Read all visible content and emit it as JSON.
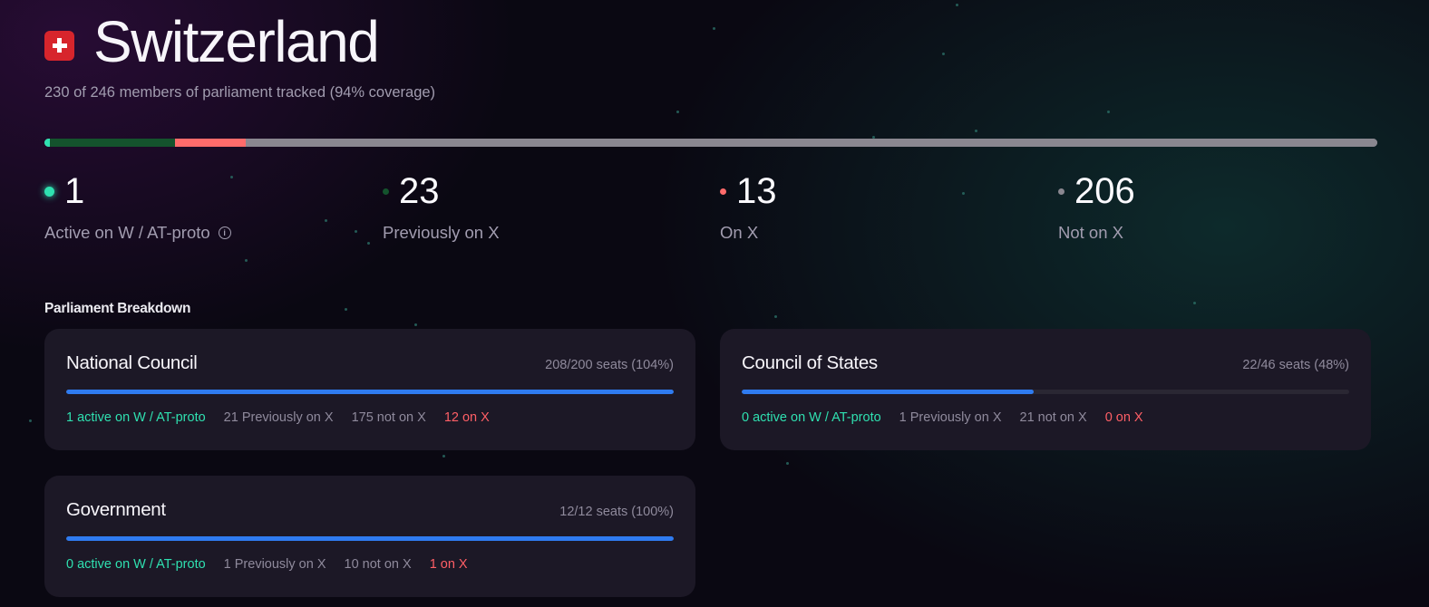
{
  "header": {
    "flag_icon": "swiss-flag-icon",
    "title": "Switzerland",
    "subtitle": "230 of 246 members of parliament tracked (94% coverage)"
  },
  "overall_bar": {
    "segments": [
      {
        "name": "active",
        "fraction": 0.004,
        "color": "#2fe0b0"
      },
      {
        "name": "previously",
        "fraction": 0.094,
        "color": "#14532d"
      },
      {
        "name": "on-x",
        "fraction": 0.053,
        "color": "#ff6b6b"
      },
      {
        "name": "not-on-x",
        "fraction": 0.849,
        "color": "#8a8790"
      }
    ]
  },
  "stats": [
    {
      "key": "active",
      "value": "1",
      "label": "Active on W / AT-proto",
      "color": "#2fe0b0",
      "info": true
    },
    {
      "key": "previously",
      "value": "23",
      "label": "Previously on X",
      "color": "#14532d",
      "info": false
    },
    {
      "key": "on-x",
      "value": "13",
      "label": "On X",
      "color": "#ff6b6b",
      "info": false
    },
    {
      "key": "not-on-x",
      "value": "206",
      "label": "Not on X",
      "color": "#8a8790",
      "info": false
    }
  ],
  "section_title": "Parliament Breakdown",
  "cards": [
    {
      "title": "National Council",
      "seats": "208/200 seats (104%)",
      "fill_fraction": 1.0,
      "active": "1 active on W / AT-proto",
      "previously": "21 Previously on X",
      "not_on_x": "175 not on X",
      "on_x": "12 on X"
    },
    {
      "title": "Council of States",
      "seats": "22/46 seats (48%)",
      "fill_fraction": 0.48,
      "active": "0 active on W / AT-proto",
      "previously": "1 Previously on X",
      "not_on_x": "21 not on X",
      "on_x": "0 on X"
    },
    {
      "title": "Government",
      "seats": "12/12 seats (100%)",
      "fill_fraction": 1.0,
      "active": "0 active on W / AT-proto",
      "previously": "1 Previously on X",
      "not_on_x": "10 not on X",
      "on_x": "1 on X"
    }
  ]
}
